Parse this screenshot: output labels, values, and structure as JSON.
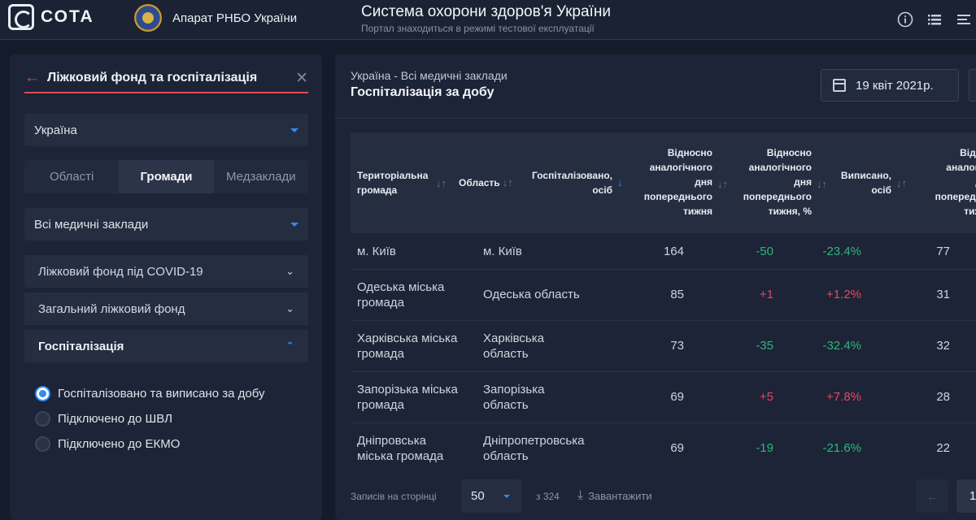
{
  "header": {
    "logo_text": "СОТА",
    "org_name": "Апарат РНБО України",
    "title": "Система охорони здоров'я України",
    "subtitle": "Портал знаходиться в режимі тестової експлуатації",
    "icons": [
      "info-icon",
      "list-icon",
      "menu-icon"
    ]
  },
  "sidebar": {
    "title": "Ліжковий фонд та госпіталізація",
    "region_select": "Україна",
    "tabs": [
      {
        "label": "Області",
        "active": false
      },
      {
        "label": "Громади",
        "active": true
      },
      {
        "label": "Медзаклади",
        "active": false
      }
    ],
    "facility_select": "Всі медичні заклади",
    "accordions": [
      {
        "label": "Ліжковий фонд під COVID-19",
        "open": false
      },
      {
        "label": "Загальний ліжковий фонд",
        "open": false
      },
      {
        "label": "Госпіталізація",
        "open": true
      }
    ],
    "radios": [
      {
        "label": "Госпіталізовано та виписано за добу",
        "checked": true
      },
      {
        "label": "Підключено до ШВЛ",
        "checked": false
      },
      {
        "label": "Підключено до ЕКМО",
        "checked": false
      }
    ]
  },
  "main": {
    "breadcrumb": "Україна - Всі медичні заклади",
    "title": "Госпіталізація за добу",
    "date": "19 квіт 2021р.",
    "columns": [
      {
        "line1": "Територіальна",
        "line2": "громада"
      },
      {
        "line1": "Область"
      },
      {
        "line1": "Госпіталізовано,",
        "line2": "осіб"
      },
      {
        "line1": "Відносно",
        "line2": "аналогічного",
        "line3": "дня",
        "line4": "попереднього",
        "line5": "тижня"
      },
      {
        "line1": "Відносно",
        "line2": "аналогічного",
        "line3": "дня",
        "line4": "попереднього",
        "line5": "тижня, %"
      },
      {
        "line1": "Виписано,",
        "line2": "осіб"
      },
      {
        "line1": "Відн",
        "line2": "аналогі",
        "line3": "д",
        "line4": "попередн",
        "line5": "тиж"
      }
    ],
    "rows": [
      {
        "community": "м. Київ",
        "community2": "",
        "oblast": "м. Київ",
        "oblast2": "",
        "hospitalized": "164",
        "diff": "-50",
        "diff_pct": "-23.4%",
        "discharged": "77"
      },
      {
        "community": "Одеська міська",
        "community2": "громада",
        "oblast": "Одеська область",
        "oblast2": "",
        "hospitalized": "85",
        "diff": "+1",
        "diff_pct": "+1.2%",
        "discharged": "31"
      },
      {
        "community": "Харківська міська",
        "community2": "громада",
        "oblast": "Харківська",
        "oblast2": "область",
        "hospitalized": "73",
        "diff": "-35",
        "diff_pct": "-32.4%",
        "discharged": "32"
      },
      {
        "community": "Запорізька міська",
        "community2": "громада",
        "oblast": "Запорізька",
        "oblast2": "область",
        "hospitalized": "69",
        "diff": "+5",
        "diff_pct": "+7.8%",
        "discharged": "28"
      },
      {
        "community": "Дніпровська",
        "community2": "міська громада",
        "oblast": "Дніпропетровська",
        "oblast2": "область",
        "hospitalized": "69",
        "diff": "-19",
        "diff_pct": "-21.6%",
        "discharged": "22"
      }
    ],
    "footer": {
      "per_page_label": "Записів на сторінці",
      "per_page": "50",
      "total": "з 324",
      "download": "Завантажити",
      "prev": "←",
      "page": "1"
    }
  },
  "colors": {
    "accent": "#2f8df0",
    "danger": "#e8485b",
    "success": "#2cb77c",
    "underline": "#e04a57"
  }
}
